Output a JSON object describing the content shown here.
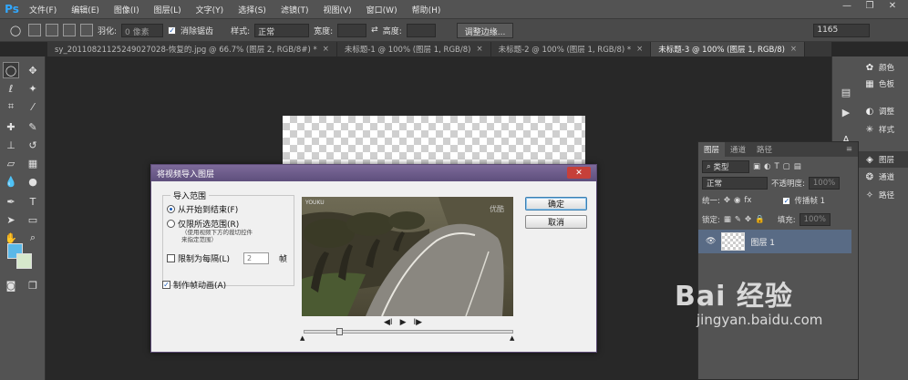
{
  "menubar": {
    "logo": "Ps",
    "items": [
      "文件(F)",
      "编辑(E)",
      "图像(I)",
      "图层(L)",
      "文字(Y)",
      "选择(S)",
      "滤镜(T)",
      "视图(V)",
      "窗口(W)",
      "帮助(H)"
    ],
    "win_min": "—",
    "win_max": "❐",
    "win_close": "✕"
  },
  "options": {
    "feather_label": "羽化:",
    "feather_value": "0 像素",
    "antialias_label": "消除锯齿",
    "style_label": "样式:",
    "style_value": "正常",
    "width_label": "宽度:",
    "height_label": "高度:",
    "refine_button": "调整边缘...",
    "workspace_value": "1165"
  },
  "tabs": [
    {
      "label": "sy_20110821125249027028-恢复的.jpg @ 66.7% (图层 2, RGB/8#) *",
      "active": false
    },
    {
      "label": "未标题-1 @ 100% (图层 1, RGB/8)",
      "active": false
    },
    {
      "label": "未标题-2 @ 100% (图层 1, RGB/8) *",
      "active": false
    },
    {
      "label": "未标题-3 @ 100% (图层 1, RGB/8)",
      "active": true
    }
  ],
  "tab_close": "×",
  "right_panel": {
    "items": [
      {
        "icon": "color-icon",
        "label": "颜色"
      },
      {
        "icon": "swatches-icon",
        "label": "色板"
      },
      {
        "icon": "adjustments-icon",
        "label": "调整"
      },
      {
        "icon": "styles-icon",
        "label": "样式"
      },
      {
        "icon": "layers-icon",
        "label": "图层"
      },
      {
        "icon": "channels-icon",
        "label": "通道"
      },
      {
        "icon": "paths-icon",
        "label": "路径"
      }
    ]
  },
  "layers_panel": {
    "tabs": [
      "图层",
      "通道",
      "路径"
    ],
    "filter_label": "类型",
    "blend_mode": "正常",
    "opacity_label": "不透明度:",
    "opacity_value": "100%",
    "unify_label": "统一:",
    "propagate_label": "传播帧 1",
    "lock_label": "锁定:",
    "fill_label": "填充:",
    "fill_value": "100%",
    "layer_name": "图层 1"
  },
  "dialog": {
    "title": "将视频导入图层",
    "close": "✕",
    "group_title": "导入范围",
    "option_all": "从开始到结束(F)",
    "option_selected": "仅限所选范围(R)",
    "hint_line1": "（使用视频下方的裁切控件",
    "hint_line2": "来指定范围）",
    "limit_label": "限制为每隔(L)",
    "limit_value": "2",
    "limit_unit": "帧",
    "animation_label": "制作帧动画(A)",
    "ok_button": "确定",
    "cancel_button": "取消",
    "player_prev": "◀I",
    "player_play": "▶",
    "player_next": "I▶",
    "preview_logo": "YOUKU",
    "preview_tag": "优酷"
  },
  "watermark": {
    "text": "Bai 经验",
    "url": "jingyan.baidu.com"
  },
  "colors": {
    "foreground": "#5ab8e8",
    "background": "#d6e8cc",
    "accent": "#31a8ff"
  }
}
